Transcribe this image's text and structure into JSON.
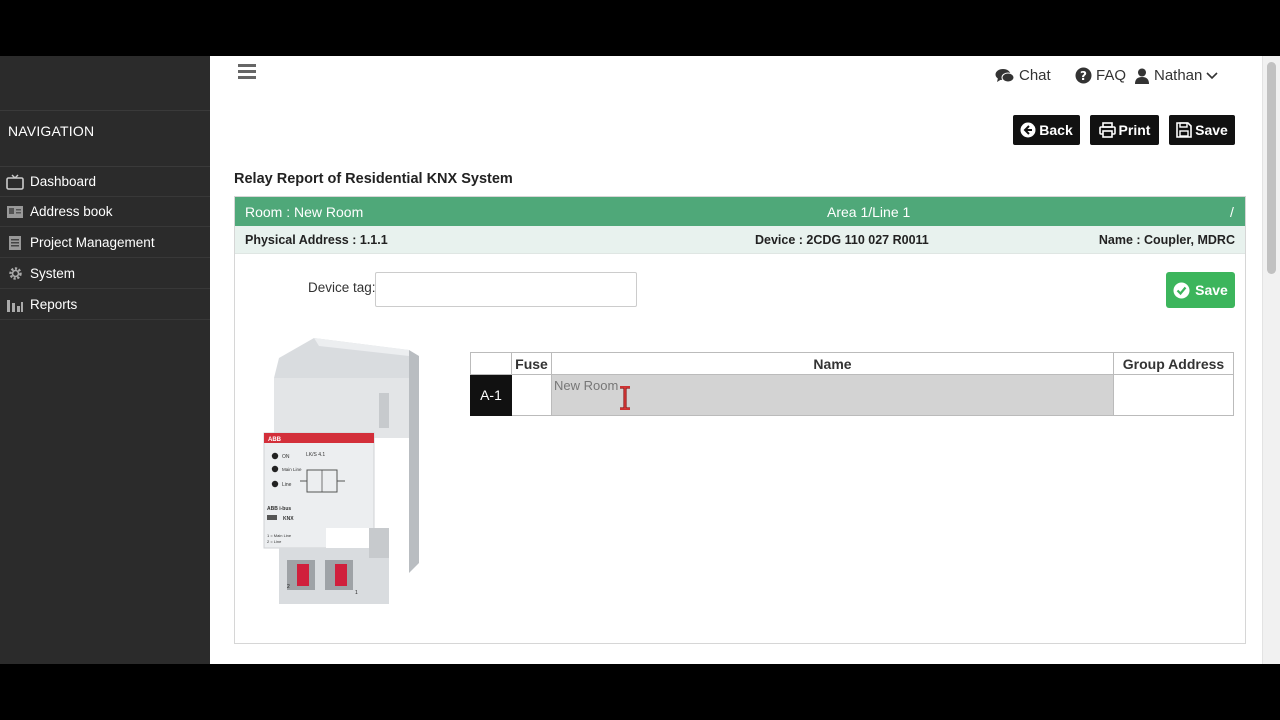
{
  "topbar": {
    "chat_label": "Chat",
    "faq_label": "FAQ",
    "user_name": "Nathan"
  },
  "sidebar": {
    "title": "NAVIGATION",
    "items": [
      {
        "label": "Dashboard",
        "icon": "tv-icon"
      },
      {
        "label": "Address book",
        "icon": "address-book-icon"
      },
      {
        "label": "Project Management",
        "icon": "list-icon"
      },
      {
        "label": "System",
        "icon": "gear-icon"
      },
      {
        "label": "Reports",
        "icon": "bar-chart-icon"
      }
    ]
  },
  "toolbar": {
    "back_label": "Back",
    "print_label": "Print",
    "save_label": "Save"
  },
  "page": {
    "title": "Relay Report of Residential KNX System"
  },
  "panel": {
    "room": "Room : New Room",
    "area_line": "Area 1/Line 1",
    "slash": "/",
    "physical_address": "Physical Address : 1.1.1",
    "device": "Device : 2CDG 110 027 R0011",
    "name": "Name : Coupler, MDRC",
    "device_tag_label": "Device tag:",
    "device_tag_value": "",
    "save_label": "Save"
  },
  "device_image_text": {
    "brand": "ABB",
    "model": "LK/S 4.1",
    "on": "ON",
    "main_line": "Main Line",
    "line": "Line",
    "bus": "ABB i-bus",
    "knx": "KNX",
    "legend_1": "1 = Main Line",
    "legend_2": "2 = Line",
    "terminal_2": "2",
    "terminal_1": "1"
  },
  "relay_table": {
    "headers": [
      "Fuse",
      "Name",
      "Group Address"
    ],
    "rows": [
      {
        "label": "A-1",
        "fuse": "",
        "name": "New Room",
        "group_address": ""
      }
    ]
  },
  "colors": {
    "sidebar_bg": "#2b2b2b",
    "panel_header": "#4fa879",
    "panel_subheader": "#e8f2ee",
    "save_green": "#3cb55c",
    "dark_button": "#111111"
  }
}
